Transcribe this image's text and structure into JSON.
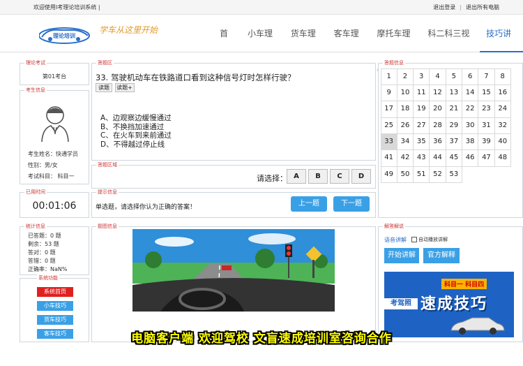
{
  "topbar": {
    "welcome": "欢迎使用Ⅰ考理论培训系统 |",
    "logout": "退出登录",
    "logout_all": "退出所有电脑"
  },
  "header": {
    "logo_text": "理论培训",
    "slogan": "学车从这里开始",
    "nav": [
      "首页",
      "小车理论",
      "货车理论",
      "客车理论",
      "摩托车理论",
      "科二科三视频",
      "技巧讲解"
    ],
    "active_nav": "技巧讲解"
  },
  "exam": {
    "title": "理论考试",
    "seat": "第01考台"
  },
  "examinee": {
    "title": "考生信息",
    "name": "考生姓名：快通学员",
    "gender": "性别：男/女",
    "subject": "考试科目：  科目一"
  },
  "timer": {
    "title": "已用时间",
    "value": "00:01:06"
  },
  "stats": {
    "title": "统计信息",
    "answered": "已答题：0 题",
    "remaining": "剩余：53 题",
    "correct": "答对：0 题",
    "wrong": "答错：0 题",
    "rate": "正确率：NaN%"
  },
  "sysfunc": {
    "title": "系统功能",
    "buttons": [
      "系统首页",
      "小车技巧",
      "货车技巧",
      "客车技巧"
    ]
  },
  "question": {
    "area_title": "答题区",
    "text": "33. 驾驶机动车在铁路道口看到这种信号灯时怎样行驶？",
    "read_btn": "读题",
    "read_plus_btn": "读题+",
    "options": [
      "A、边观察边缓慢通过",
      "B、不换挡加速通过",
      "C、在火车到来前通过",
      "D、不得越过停止线"
    ]
  },
  "answer_area": {
    "title": "答题区域",
    "prompt": "请选择：",
    "choices": [
      "A",
      "B",
      "C",
      "D"
    ]
  },
  "hint": {
    "title": "提示信息",
    "text": "单选题，请选择你认为正确的答案！",
    "prev": "上一题",
    "next": "下一题"
  },
  "image_info": {
    "title": "题图信息"
  },
  "answer_info": {
    "title": "答题信息",
    "numbers": [
      "1",
      "2",
      "3",
      "4",
      "5",
      "6",
      "7",
      "8",
      "9",
      "10",
      "11",
      "12",
      "13",
      "14",
      "15",
      "16",
      "17",
      "18",
      "19",
      "20",
      "21",
      "22",
      "23",
      "24",
      "25",
      "26",
      "27",
      "28",
      "29",
      "30",
      "31",
      "32",
      "33",
      "34",
      "35",
      "36",
      "37",
      "38",
      "39",
      "40",
      "41",
      "42",
      "43",
      "44",
      "45",
      "46",
      "47",
      "48",
      "49",
      "50",
      "51",
      "52",
      "53"
    ],
    "current": "33"
  },
  "explain": {
    "title": "解答解说",
    "voice": "语音讲解",
    "auto_play": "自动播放讲解",
    "start": "开始讲解",
    "official": "官方解释",
    "ad_left": "考驾照",
    "ad_tag": "科目一 科目四",
    "ad_big": "速成技巧"
  },
  "banner": {
    "text": "电脑客户端  欢迎驾校  文盲速成培训室咨询合作"
  },
  "colors": {
    "accent": "#2a6fc9",
    "button_blue": "#3aa0e6",
    "home_red": "#e02020",
    "banner_yellow": "#ffff00"
  }
}
